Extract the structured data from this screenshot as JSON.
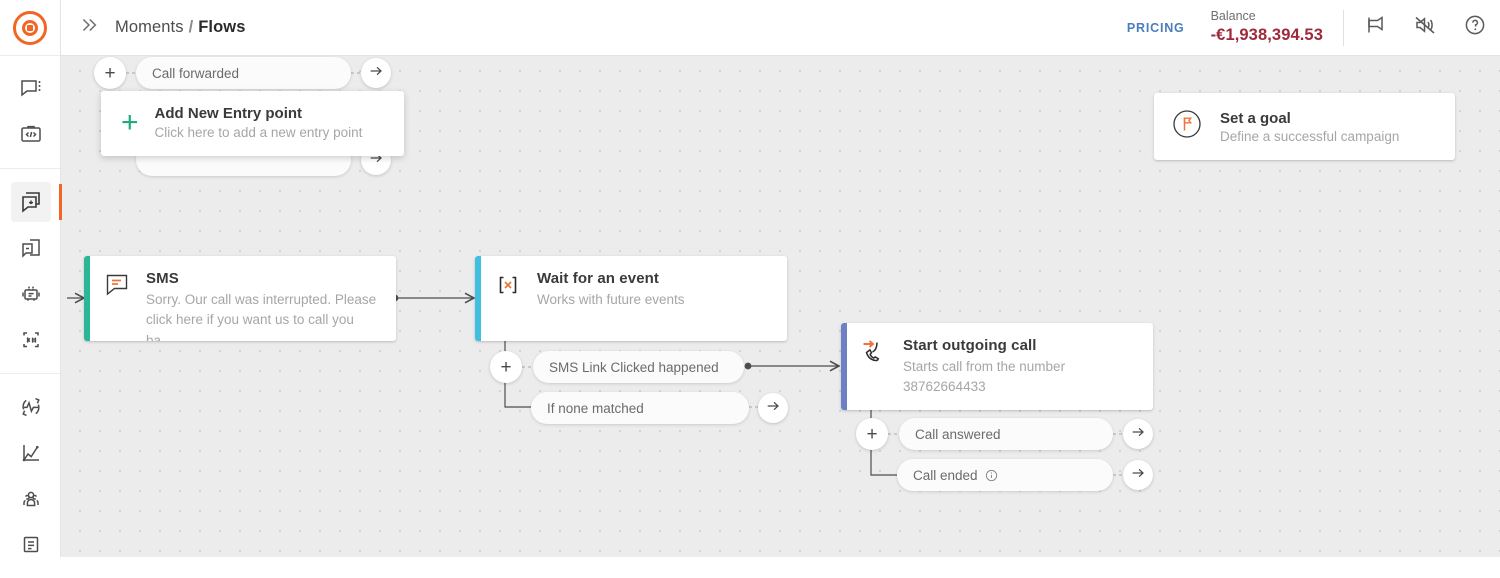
{
  "app": {
    "logo": "infobip-logo-icon"
  },
  "sidebar": {
    "collapse_icon": "chevrons-right-icon",
    "groups": [
      {
        "items": [
          {
            "name": "sidebar-item-conversations",
            "icon": "chat-bubble-icon",
            "active": false
          },
          {
            "name": "sidebar-item-developer",
            "icon": "code-suitcase-icon",
            "active": false
          }
        ]
      },
      {
        "items": [
          {
            "name": "sidebar-item-moments",
            "icon": "flows-stacked-chat-icon",
            "active": true
          },
          {
            "name": "sidebar-item-broadcast",
            "icon": "broadcast-pages-icon",
            "active": false
          },
          {
            "name": "sidebar-item-answers",
            "icon": "robot-icon",
            "active": false
          },
          {
            "name": "sidebar-item-keywords",
            "icon": "star-hash-icon",
            "active": false
          }
        ]
      },
      {
        "items": [
          {
            "name": "sidebar-item-exchange",
            "icon": "pulse-compass-icon",
            "active": false
          },
          {
            "name": "sidebar-item-analyze",
            "icon": "line-chart-icon",
            "active": false
          },
          {
            "name": "sidebar-item-people",
            "icon": "people-icon",
            "active": false
          },
          {
            "name": "sidebar-item-documents",
            "icon": "document-icon",
            "active": false
          }
        ]
      }
    ]
  },
  "header": {
    "breadcrumb": {
      "root": "Moments",
      "separator": "/",
      "current": "Flows"
    },
    "pricing_label": "PRICING",
    "balance_label": "Balance",
    "balance_value": "-€1,938,394.53",
    "balance_color": "#9e2a3c",
    "icons": [
      {
        "name": "announcements-megaphone-icon",
        "glyph": "megaphone"
      },
      {
        "name": "mute-speaker-icon",
        "glyph": "speaker-mute"
      },
      {
        "name": "help-question-icon",
        "glyph": "question-circle"
      }
    ]
  },
  "canvas": {
    "entry": {
      "pill_label": "Call forwarded",
      "plus_label": "+",
      "arrow_label": "→"
    },
    "entry_panel": {
      "title": "Add New Entry point",
      "subtitle": "Click here to add a new entry point",
      "plus_glyph": "+"
    },
    "goal_card": {
      "icon": "flag-goal-icon",
      "title": "Set a goal",
      "subtitle": "Define a successful campaign"
    },
    "nodes": [
      {
        "name": "node-sms",
        "icon": "sms-message-icon",
        "title": "SMS",
        "subtitle": "Sorry. Our call was interrupted. Please click here if you want us to call you ba...",
        "accent": "#2bb697"
      },
      {
        "name": "node-wait-for-event",
        "icon": "wait-event-icon",
        "title": "Wait for an event",
        "subtitle": "Works with future events",
        "accent": "#41bfe0"
      },
      {
        "name": "node-start-outgoing-call",
        "icon": "outgoing-call-icon",
        "title": "Start outgoing call",
        "subtitle": "Starts call from the number",
        "subtitle2": "38762664433",
        "accent": "#6f7fc4"
      }
    ],
    "branches": [
      {
        "name": "branch-sms-link-clicked",
        "label": "SMS Link Clicked happened",
        "has_info": false,
        "has_arrow": false
      },
      {
        "name": "branch-if-none-matched",
        "label": "If none matched",
        "has_info": false,
        "has_arrow": true
      },
      {
        "name": "branch-call-answered",
        "label": "Call answered",
        "has_info": false,
        "has_arrow": true
      },
      {
        "name": "branch-call-ended",
        "label": "Call ended",
        "has_info": true,
        "has_arrow": true
      }
    ],
    "info_glyph": "ⓘ",
    "arrow_glyph": "→",
    "plus_glyph": "+"
  }
}
